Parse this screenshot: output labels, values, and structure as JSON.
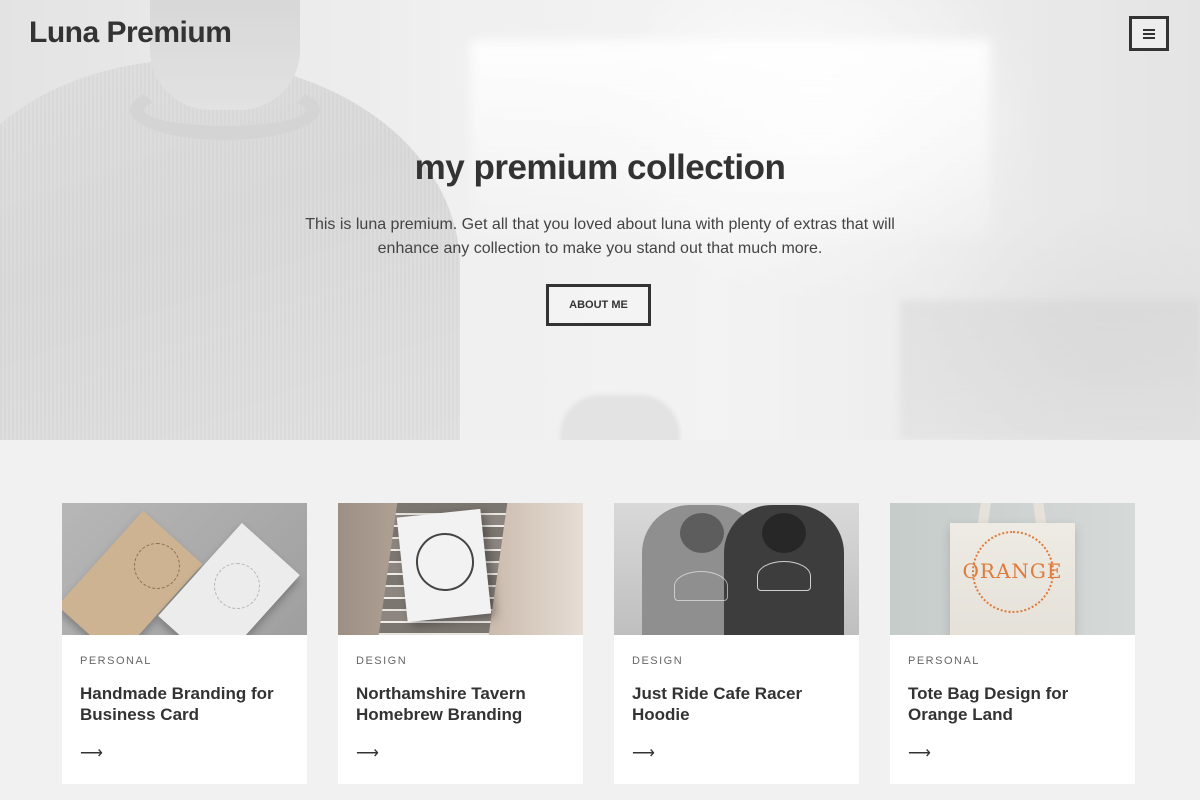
{
  "site": {
    "title": "Luna Premium",
    "menu_icon": "hamburger-icon"
  },
  "hero": {
    "title": "my premium collection",
    "description": "This is luna premium. Get all that you loved about luna with plenty of extras that will enhance any collection to make you stand out that much more.",
    "button_label": "ABOUT ME"
  },
  "cards": [
    {
      "category": "PERSONAL",
      "title": "Handmade Branding for Business Card",
      "arrow": "⟶"
    },
    {
      "category": "DESIGN",
      "title": "Northamshire Tavern Homebrew Branding",
      "arrow": "⟶"
    },
    {
      "category": "DESIGN",
      "title": "Just Ride Cafe Racer Hoodie",
      "arrow": "⟶"
    },
    {
      "category": "PERSONAL",
      "title": "Tote Bag Design for Orange Land",
      "arrow": "⟶",
      "thumb_logo_text": "ORANGE"
    }
  ],
  "colors": {
    "text": "#333333",
    "page_background": "#f1f1f1",
    "card_background": "#ffffff",
    "orange_accent": "#e07a3a"
  }
}
